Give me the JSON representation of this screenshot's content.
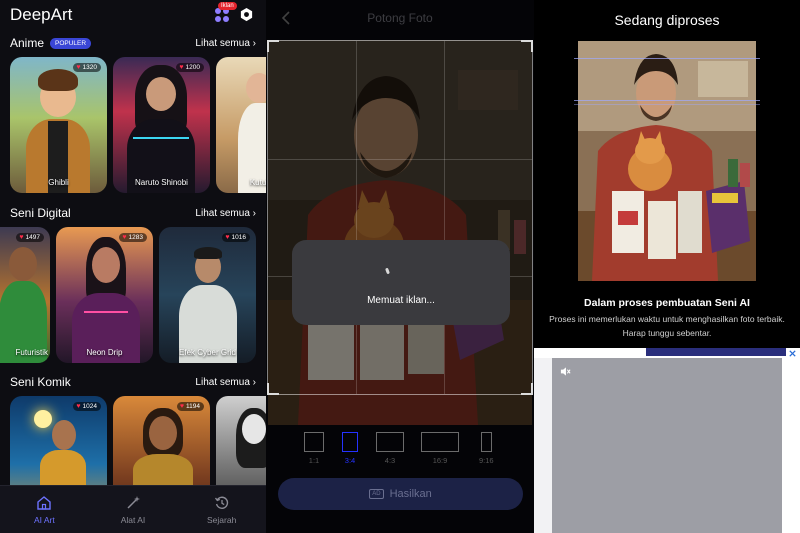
{
  "panel1": {
    "app_title": "DeepArt",
    "ad_badge": "Iklan",
    "sections": [
      {
        "title": "Anime",
        "badge": "POPULER",
        "see_all": "Lihat semua",
        "cards": [
          {
            "caption": "Ghibli",
            "likes": "1320"
          },
          {
            "caption": "Naruto Shinobi",
            "likes": "1200"
          },
          {
            "caption": "Kutukan",
            "likes": ""
          }
        ]
      },
      {
        "title": "Seni Digital",
        "see_all": "Lihat semua",
        "cards": [
          {
            "caption": "Futuristik",
            "likes": "1497"
          },
          {
            "caption": "Neon Drip",
            "likes": "1283"
          },
          {
            "caption": "Efek Cyber Grid",
            "likes": "1016"
          }
        ]
      },
      {
        "title": "Seni Komik",
        "see_all": "Lihat semua",
        "cards": [
          {
            "caption": "",
            "likes": "1024"
          },
          {
            "caption": "",
            "likes": "1194"
          },
          {
            "caption": "",
            "likes": ""
          }
        ]
      }
    ],
    "bottom_nav": [
      {
        "label": "AI Art",
        "icon": "home-icon"
      },
      {
        "label": "Alat AI",
        "icon": "magic-wand-icon"
      },
      {
        "label": "Sejarah",
        "icon": "history-icon"
      }
    ]
  },
  "panel2": {
    "title": "Potong Foto",
    "loading_text": "Memuat iklan...",
    "ratios": [
      {
        "label": "1:1"
      },
      {
        "label": "3:4",
        "selected": true
      },
      {
        "label": "4:3"
      },
      {
        "label": "16:9"
      },
      {
        "label": "9:16"
      }
    ],
    "ad_mark": "AD",
    "generate_label": "Hasilkan"
  },
  "panel3": {
    "title": "Sedang diproses",
    "heading": "Dalam proses pembuatan Seni AI",
    "description": "Proses ini memerlukan waktu untuk menghasilkan foto terbaik. Harap tunggu sebentar."
  },
  "colors": {
    "accent": "#6d72ff",
    "badge_blue": "#3a46d6",
    "like_red": "#ff2d4b",
    "selected_ratio": "#2532ff"
  }
}
